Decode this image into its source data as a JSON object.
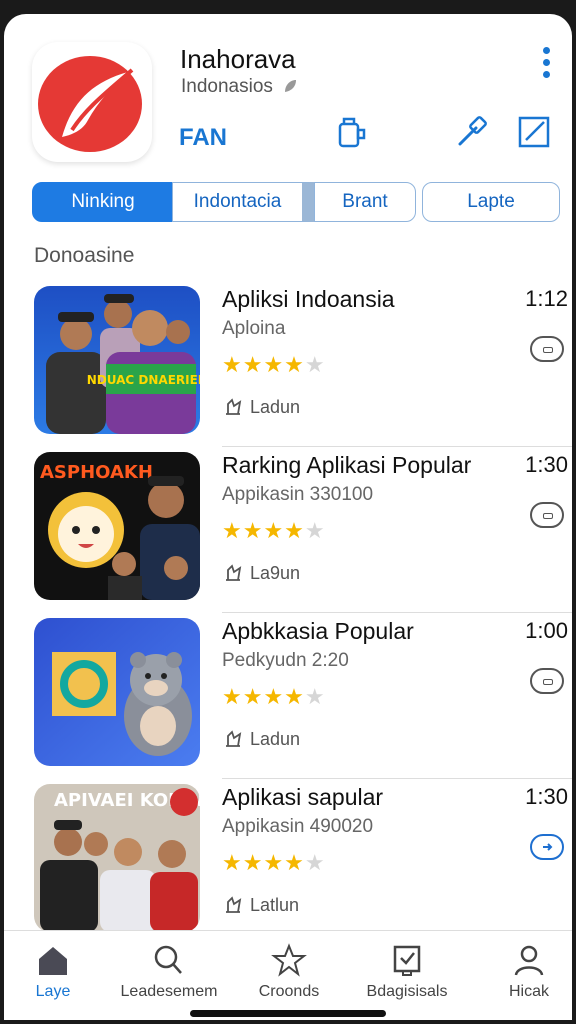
{
  "header": {
    "title": "Inahorava",
    "subtitle": "Indonasios",
    "fan_label": "FAN",
    "icons": [
      "app-logo-icon",
      "leaf-icon",
      "more-vert-icon",
      "bag-icon",
      "hammer-icon",
      "edit-square-icon"
    ],
    "accent": "#1976d2",
    "logo_color": "#e53935"
  },
  "chips": [
    {
      "label": "Ninking",
      "active": true
    },
    {
      "label": "Indontacia",
      "active": false
    },
    {
      "label": "Brant",
      "active": false
    },
    {
      "label": "Lapte",
      "active": false
    }
  ],
  "section": {
    "title": "Donoasine"
  },
  "apps": [
    {
      "name": "Apliksi Indoansia",
      "sub": "Aploina",
      "time": "1:12",
      "rating": 4,
      "action": "Ladun",
      "thumb_text": "NDUAC DNAERIERO"
    },
    {
      "name": "Rarking Aplikasi Popular",
      "sub": "Appikasin 330100",
      "time": "1:30",
      "rating": 4,
      "action": "La9un",
      "thumb_text": "ASPHOAKH"
    },
    {
      "name": "Apbkkasia Popular",
      "sub": "Pedkyudn  2:20",
      "time": "1:00",
      "rating": 4,
      "action": "Ladun",
      "thumb_text": ""
    },
    {
      "name": "Aplikasi sapular",
      "sub": "Appikasin 490020",
      "time": "1:30",
      "rating": 4,
      "action": "Latlun",
      "thumb_text": "APIVAEI KOKIN"
    }
  ],
  "nav": [
    {
      "label": "Laye",
      "icon": "home-icon",
      "active": true
    },
    {
      "label": "Leadesemem",
      "icon": "search-icon",
      "active": false
    },
    {
      "label": "Croonds",
      "icon": "star-icon",
      "active": false
    },
    {
      "label": "Bdagisisals",
      "icon": "clipboard-check-icon",
      "active": false
    },
    {
      "label": "Hicak",
      "icon": "person-icon",
      "active": false
    }
  ]
}
